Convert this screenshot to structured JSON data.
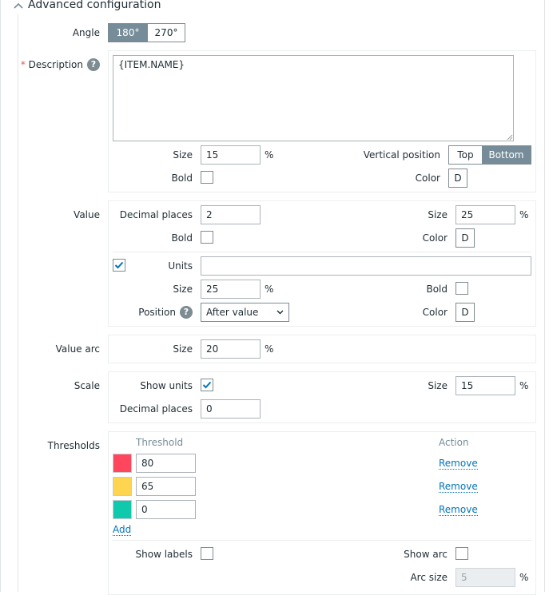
{
  "section": {
    "title": "Advanced configuration"
  },
  "angle": {
    "label": "Angle",
    "options": [
      "180°",
      "270°"
    ],
    "selected": "180°"
  },
  "description": {
    "label": "Description",
    "required_mark": "*",
    "help": "?",
    "value": "{ITEM.NAME}",
    "size_label": "Size",
    "size_value": "15",
    "unit": "%",
    "bold_label": "Bold",
    "bold_checked": false,
    "vpos_label": "Vertical position",
    "vpos_options": [
      "Top",
      "Bottom"
    ],
    "vpos_selected": "Bottom",
    "color_label": "Color",
    "color_value": "D"
  },
  "value": {
    "label": "Value",
    "decimal_label": "Decimal places",
    "decimal_value": "2",
    "size_label": "Size",
    "size_value": "25",
    "unit": "%",
    "bold_label": "Bold",
    "bold_checked": false,
    "color_label": "Color",
    "color_value": "D",
    "units_checked": true,
    "units_label": "Units",
    "units_value": "",
    "units_size_label": "Size",
    "units_size_value": "25",
    "units_bold_label": "Bold",
    "units_bold_checked": false,
    "position_label": "Position",
    "position_help": "?",
    "position_value": "After value",
    "units_color_label": "Color",
    "units_color_value": "D"
  },
  "value_arc": {
    "label": "Value arc",
    "size_label": "Size",
    "size_value": "20",
    "unit": "%"
  },
  "scale": {
    "label": "Scale",
    "show_units_label": "Show units",
    "show_units_checked": true,
    "size_label": "Size",
    "size_value": "15",
    "unit": "%",
    "decimal_label": "Decimal places",
    "decimal_value": "0"
  },
  "thresholds": {
    "label": "Thresholds",
    "col_threshold": "Threshold",
    "col_action": "Action",
    "rows": [
      {
        "color": "#ff465c",
        "value": "80",
        "action": "Remove"
      },
      {
        "color": "#ffd54f",
        "value": "65",
        "action": "Remove"
      },
      {
        "color": "#0ec9ac",
        "value": "0",
        "action": "Remove"
      }
    ],
    "add_label": "Add",
    "show_labels_label": "Show labels",
    "show_labels_checked": false,
    "show_arc_label": "Show arc",
    "show_arc_checked": false,
    "arc_size_label": "Arc size",
    "arc_size_value": "5",
    "unit": "%"
  },
  "colors": {
    "accent": "#0275b8",
    "segment_on": "#768d99",
    "border": "#7d8b93"
  }
}
